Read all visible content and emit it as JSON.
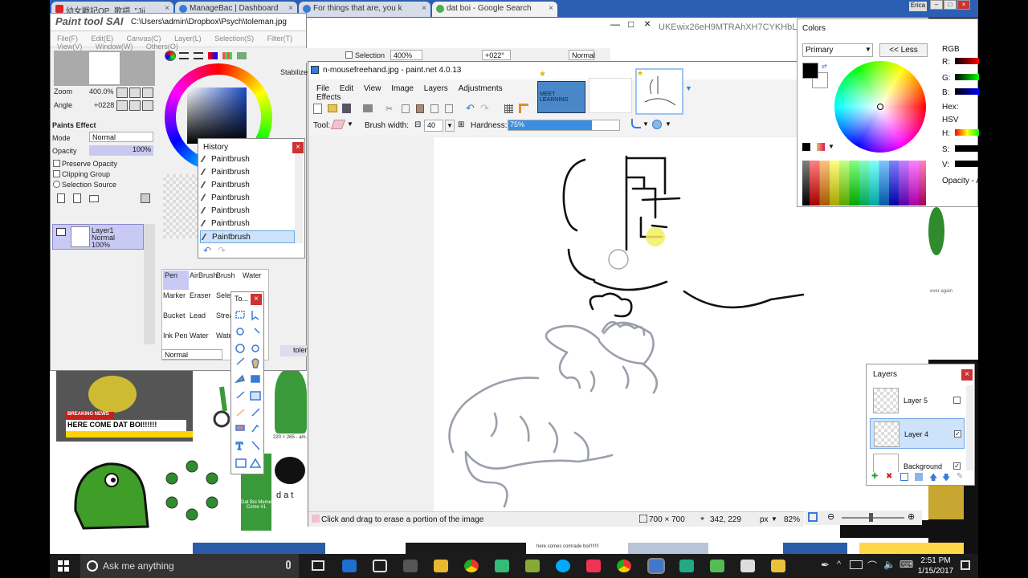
{
  "browser": {
    "tabs": [
      {
        "label": "幼女戦記OP_歌詞_\"Jii",
        "color": "#e02424"
      },
      {
        "label": "ManageBac | Dashboard",
        "color": "#3a7bd5"
      },
      {
        "label": "For things that are, you k",
        "color": "#3a7bd5"
      },
      {
        "label": "dat boi - Google Search",
        "color": "#4caf50"
      }
    ],
    "url_fragment": "UKEwix26eH9MTRAhXH7CYKHbLG",
    "user_badge": "Erica",
    "page_text_1": "BREAKING NEWS",
    "page_text_2": "HERE COME DAT BOI!!!!!!",
    "page_text_3": "here comes comrade boi!!!!!!!",
    "page_text_4": "ever again",
    "page_text_5": "Dat Boi Meme Come #1",
    "page_text_6": "dat",
    "page_text_7": "220 × 265 - am..."
  },
  "sai": {
    "app_name": "Paint tool SAI",
    "path": "C:\\Users\\admin\\Dropbox\\Psych\\toleman.jpg",
    "menu": [
      "File(F)",
      "Edit(E)",
      "Canvas(C)",
      "Layer(L)",
      "Selection(S)",
      "Filter(T)",
      "View(V)",
      "Window(W)",
      "Others(O)"
    ],
    "zoom_label": "Zoom",
    "zoom_value": "400.0%",
    "angle_label": "Angle",
    "angle_value": "+0228",
    "selection_label": "Selection",
    "toolbar_zoom": "400%",
    "toolbar_angle": "+022°",
    "toolbar_mode": "Normal",
    "stabilizer_label": "Stabilizer",
    "paints_effect": "Paints Effect",
    "mode_label": "Mode",
    "mode_value": "Normal",
    "opacity_label": "Opacity",
    "opacity_value": "100%",
    "preserve_opacity": "Preserve Opacity",
    "clipping_group": "Clipping Group",
    "selection_source": "Selection Source",
    "layer_name": "Layer1",
    "layer_mode": "Normal",
    "layer_opacity": "100%",
    "brush_tools": [
      "Pen",
      "AirBrush",
      "Brush",
      "Water",
      "Marker",
      "Eraser",
      "Selec",
      "Bucket",
      "Lead",
      "Strea",
      "Ink Pen",
      "Water",
      "Water"
    ],
    "blend_bottom": "Normal",
    "task_label": "toler"
  },
  "history": {
    "title": "History",
    "items": [
      "Paintbrush",
      "Paintbrush",
      "Paintbrush",
      "Paintbrush",
      "Paintbrush",
      "Paintbrush",
      "Paintbrush"
    ]
  },
  "toolbox": {
    "title": "To..."
  },
  "pdn": {
    "title": "n-mousefreehand.jpg - paint.net 4.0.13",
    "menu": [
      "File",
      "Edit",
      "View",
      "Image",
      "Layers",
      "Adjustments",
      "Effects"
    ],
    "thumb_label": "MEET LEARNING",
    "tool_label": "Tool:",
    "brush_width_label": "Brush width:",
    "brush_width_value": "40",
    "hardness_label": "Hardness:",
    "hardness_value": "75%",
    "hardness_fraction": 0.75,
    "status_hint": "Click and drag to erase a portion of the image",
    "image_size": "700 × 700",
    "cursor_pos": "342, 229",
    "unit": "px",
    "zoom": "82%"
  },
  "colors": {
    "title": "Colors",
    "mode": "Primary",
    "less_button": "<< Less",
    "rgb_label": "RGB",
    "r_label": "R:",
    "g_label": "G:",
    "b_label": "B:",
    "hex_label": "Hex:",
    "hsv_label": "HSV",
    "h_label": "H:",
    "s_label": "S:",
    "v_label": "V:",
    "opacity_label": "Opacity - A",
    "primary_color": "#000000",
    "secondary_color": "#ffffff"
  },
  "layers_panel": {
    "title": "Layers",
    "items": [
      {
        "name": "Layer 5",
        "visible": false,
        "selected": false
      },
      {
        "name": "Layer 4",
        "visible": true,
        "selected": true
      },
      {
        "name": "Background",
        "visible": true,
        "selected": false
      }
    ]
  },
  "taskbar": {
    "search_placeholder": "Ask me anything",
    "time": "2:51 PM",
    "date": "1/15/2017"
  }
}
